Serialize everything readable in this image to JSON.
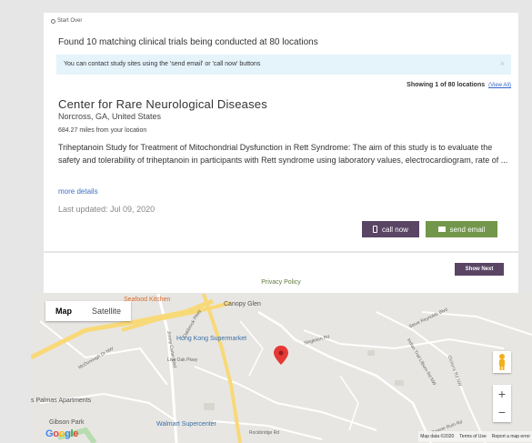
{
  "start_over": "Start Over",
  "found_text": "Found 10 matching clinical trials being conducted at 80 locations",
  "info_text": "You can contact study sites using the 'send email' or 'call now' buttons",
  "info_close": "×",
  "showing_text": "Showing 1 of 80 locations",
  "view_all": "(View All)",
  "site": {
    "name": "Center for Rare Neurological Diseases",
    "location": "Norcross, GA, United States",
    "distance": "684.27 miles from your location",
    "description": "Triheptanoin Study for Treatment of Mitochondrial Dysfunction in Rett Syndrome: The aim of this study is to evaluate the safety and tolerability of triheptanoin in participants with Rett syndrome using laboratory values, electrocardiogram, rate of ...",
    "more_details": "more details",
    "last_updated": "Last updated: Jul 09, 2020"
  },
  "buttons": {
    "call": "call now",
    "email": "send email",
    "show_next": "Show Next"
  },
  "privacy": "Privacy Policy",
  "map": {
    "type_map": "Map",
    "type_satellite": "Satellite",
    "labels": {
      "seafood": "Seafood Kitchen",
      "canopy": "Canopy Glen",
      "hongkong": "Hong Kong Supermarket",
      "palmas": "s Palmas Apartments",
      "walmart": "Walmart Supercenter",
      "park": "Gibson Park"
    },
    "roads": {
      "jimmy": "Jimmy Carter Blvd",
      "oakbrook": "Oakbrook Pkwy",
      "singleton": "Singleton Rd",
      "steve": "Steve Reynolds Blvd",
      "indian": "Indian Trail Lilburn Rd NW",
      "dickens": "Dickens Rd NW",
      "live_oak": "Live Oak Pkwy",
      "mcdonough": "McDonough Dr NW",
      "beaver": "Beaver Ruin Rd",
      "rockbridge": "Rockbridge Rd"
    },
    "zoom_in": "+",
    "zoom_out": "−",
    "google": "Google",
    "map_data": "Map data ©2020",
    "terms": "Terms of Use",
    "report": "Report a map error"
  },
  "colors": {
    "purple": "#5a4565",
    "green": "#72964a",
    "info_bg": "#e5f3fb",
    "pin": "#e53935"
  }
}
